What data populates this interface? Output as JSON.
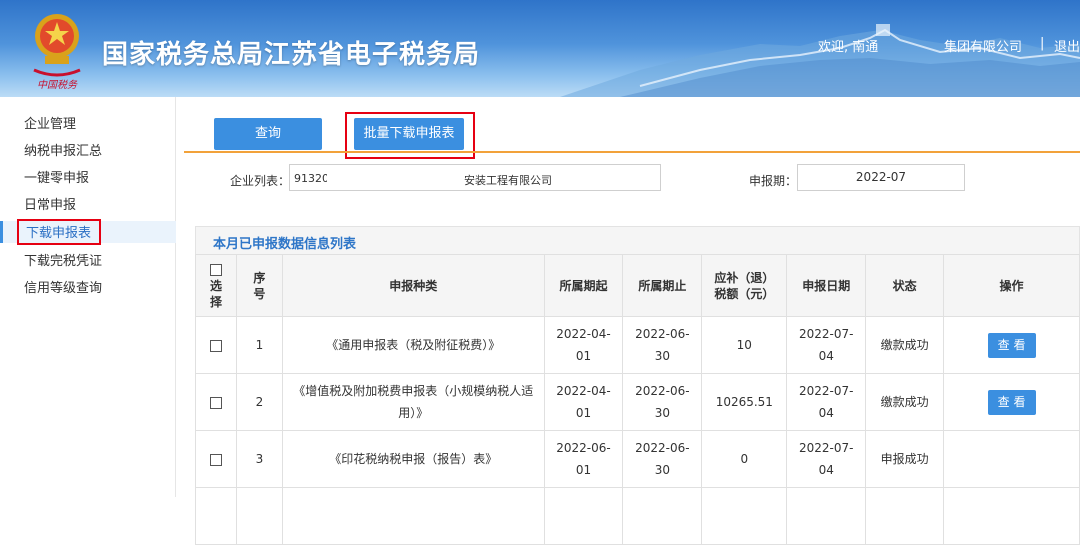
{
  "header": {
    "title": "国家税务总局江苏省电子税务局",
    "logo_caption": "中国税务",
    "welcome": "欢迎, 南通",
    "company": "集团有限公司",
    "separator": "|",
    "logout": "退出"
  },
  "sidebar": {
    "items": [
      {
        "label": "企业管理"
      },
      {
        "label": "纳税申报汇总"
      },
      {
        "label": "一键零申报"
      },
      {
        "label": "日常申报"
      },
      {
        "label": "下载申报表",
        "active": true
      },
      {
        "label": "下载完税凭证"
      },
      {
        "label": "信用等级查询"
      }
    ]
  },
  "toolbar": {
    "query_label": "查询",
    "batch_download_label": "批量下载申报表"
  },
  "filters": {
    "company_label": "企业列表：",
    "company_id": "913206",
    "company_name": "安装工程有限公司",
    "period_label": "申报期：",
    "period_value": "2022-07"
  },
  "table": {
    "title": "本月已申报数据信息列表",
    "headers": {
      "select": [
        "选",
        "择"
      ],
      "index": [
        "序",
        "号"
      ],
      "type": "申报种类",
      "period_start": "所属期起",
      "period_end": "所属期止",
      "tax_amount": [
        "应补（退）",
        "税额（元）"
      ],
      "declare_date": "申报日期",
      "status": "状态",
      "action": "操作"
    },
    "rows": [
      {
        "index": "1",
        "type": [
          "《通用申报表（税及附征税费）》"
        ],
        "period_start": [
          "2022-04-",
          "01"
        ],
        "period_end": [
          "2022-06-",
          "30"
        ],
        "tax_amount": "10",
        "declare_date": [
          "2022-07-",
          "04"
        ],
        "status": "缴款成功",
        "action": "查 看"
      },
      {
        "index": "2",
        "type": [
          "《增值税及附加税费申报表（小规模纳税人适",
          "用）》"
        ],
        "period_start": [
          "2022-04-",
          "01"
        ],
        "period_end": [
          "2022-06-",
          "30"
        ],
        "tax_amount": "10265.51",
        "declare_date": [
          "2022-07-",
          "04"
        ],
        "status": "缴款成功",
        "action": "查 看"
      },
      {
        "index": "3",
        "type": [
          "《印花税纳税申报（报告）表》"
        ],
        "period_start": [
          "2022-06-",
          "01"
        ],
        "period_end": [
          "2022-06-",
          "30"
        ],
        "tax_amount": "0",
        "declare_date": [
          "2022-07-",
          "04"
        ],
        "status": "申报成功",
        "action": ""
      }
    ]
  },
  "colors": {
    "primary_button": "#3b8fe0",
    "highlight_box": "#e60012",
    "accent_line": "#f2a23a",
    "table_title": "#2e76c8"
  }
}
